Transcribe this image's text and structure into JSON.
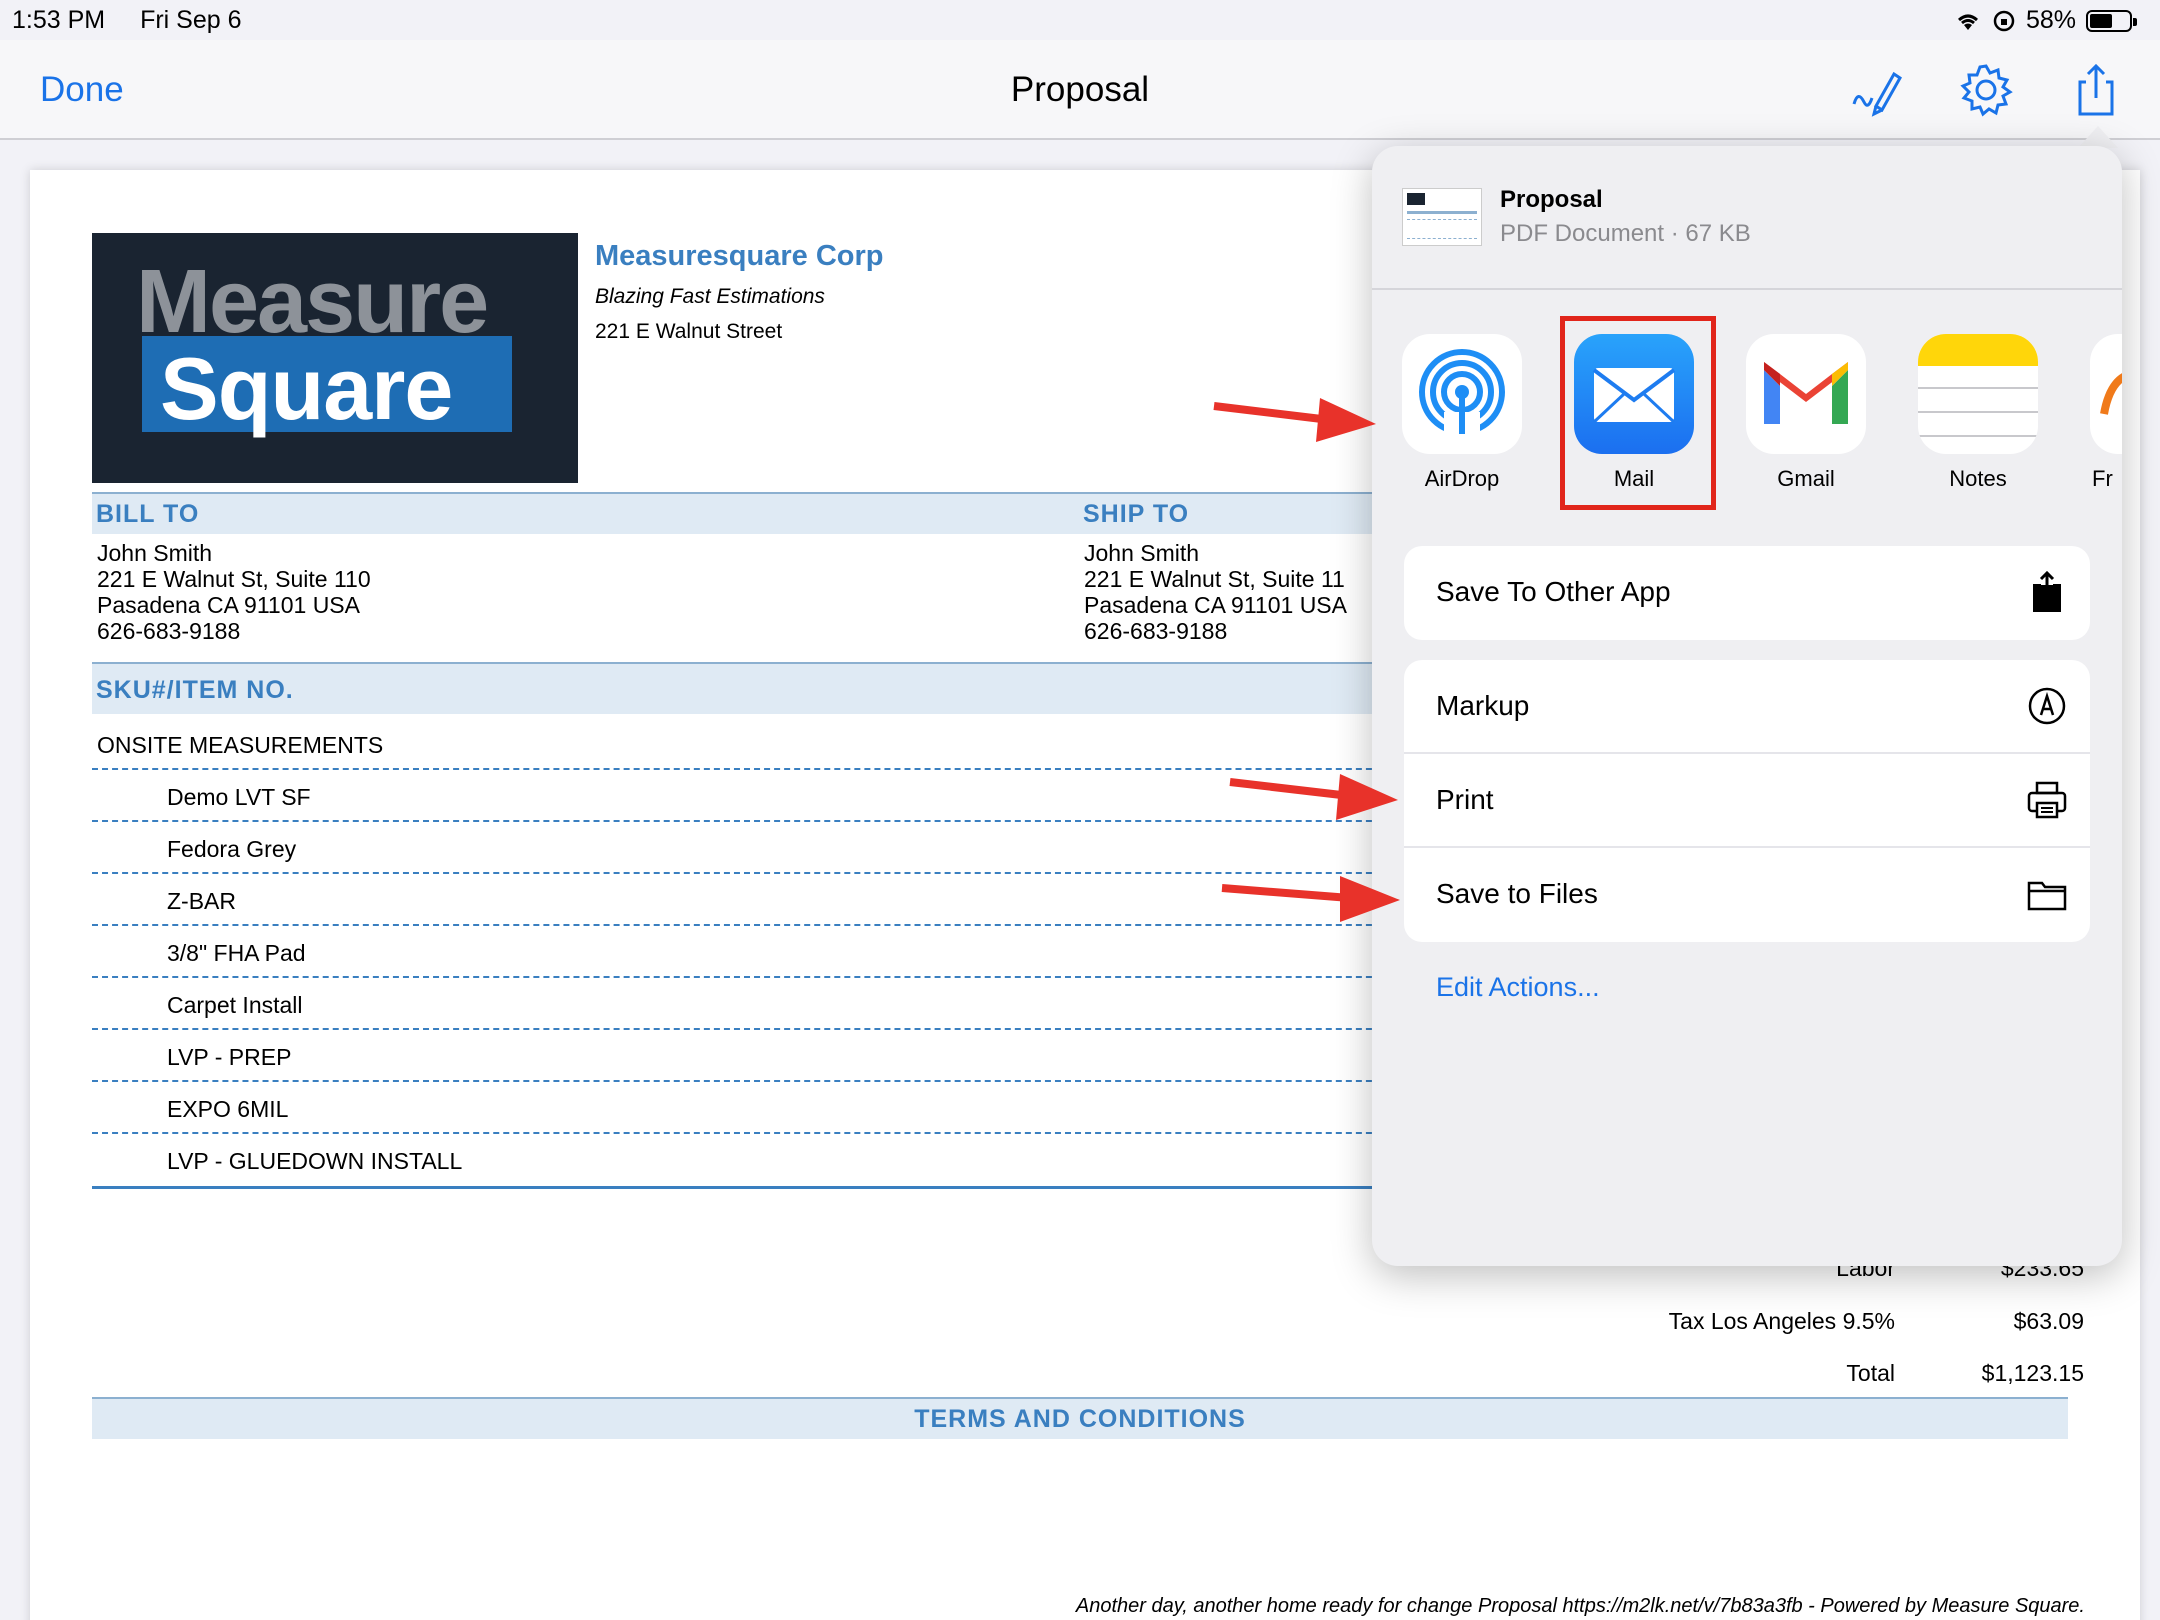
{
  "status": {
    "time": "1:53 PM",
    "date": "Fri Sep 6",
    "battery": "58%",
    "battery_level": 0.58
  },
  "nav": {
    "done": "Done",
    "title": "Proposal"
  },
  "document": {
    "logo": {
      "line1": "Measure",
      "line2": "Square"
    },
    "company": "Measuresquare Corp",
    "tagline": "Blazing Fast Estimations",
    "street": "221 E Walnut Street",
    "bill_to": {
      "header": "BILL TO",
      "lines": [
        "John Smith",
        "221 E Walnut St, Suite 110",
        "Pasadena CA 91101 USA",
        "626-683-9188"
      ]
    },
    "ship_to": {
      "header": "SHIP TO",
      "lines": [
        "John Smith",
        "221 E Walnut St, Suite 11",
        "Pasadena CA 91101 USA",
        "626-683-9188"
      ]
    },
    "items_header": "SKU#/ITEM NO.",
    "section": "ONSITE MEASUREMENTS",
    "items": [
      "Demo LVT SF",
      "Fedora Grey",
      "Z-BAR",
      "3/8\" FHA Pad",
      "Carpet Install",
      "LVP - PREP",
      "EXPO 6MIL",
      "LVP - GLUEDOWN INSTALL"
    ],
    "summary": [
      {
        "label": "Labor",
        "value": "$233.65"
      },
      {
        "label": "Tax Los Angeles 9.5%",
        "value": "$63.09"
      },
      {
        "label": "Total",
        "value": "$1,123.15"
      }
    ],
    "terms": "TERMS AND CONDITIONS",
    "footer": "Another day, another home ready for change Proposal https://m2lk.net/v/7b83a3fb - Powered by Measure Square."
  },
  "share_sheet": {
    "file_name": "Proposal",
    "file_info": "PDF Document · 67 KB",
    "apps": [
      {
        "label": "AirDrop",
        "icon": "airdrop-icon"
      },
      {
        "label": "Mail",
        "icon": "mail-icon"
      },
      {
        "label": "Gmail",
        "icon": "gmail-icon"
      },
      {
        "label": "Notes",
        "icon": "notes-icon"
      },
      {
        "label": "Fr",
        "icon": "partial-app-icon"
      }
    ],
    "save_other": "Save To Other App",
    "actions": [
      "Markup",
      "Print",
      "Save to Files"
    ],
    "edit_actions": "Edit Actions..."
  },
  "colors": {
    "accent": "#1a73e8",
    "doc_blue": "#3a7fc0",
    "highlight_red": "#e1251b"
  }
}
